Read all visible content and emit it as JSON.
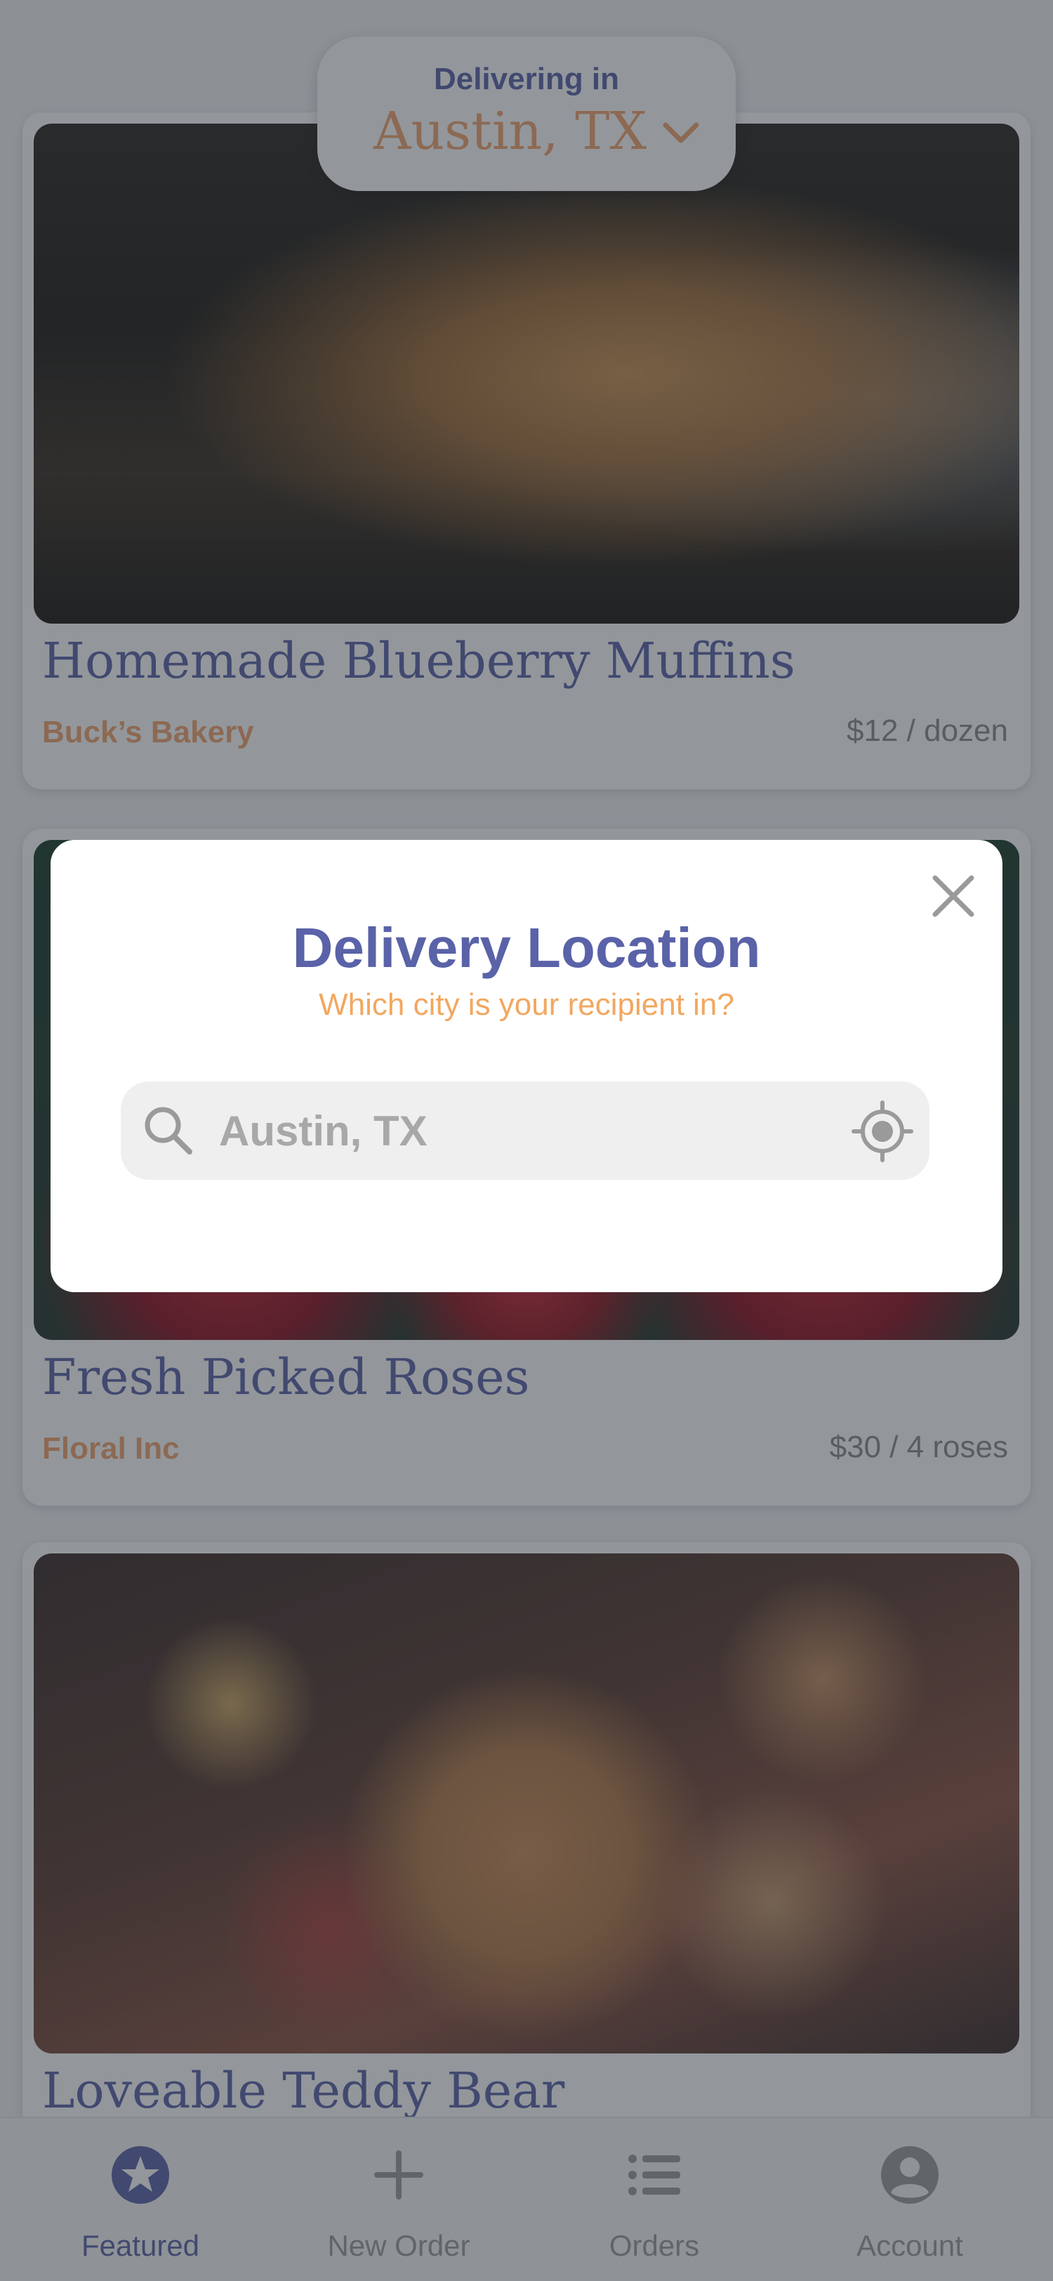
{
  "header": {
    "delivering_label": "Delivering in",
    "city": "Austin, TX"
  },
  "products": [
    {
      "title": "Homemade Blueberry Muffins",
      "shop": "Buck’s Bakery",
      "price": "$12 / dozen",
      "image": "muffins-photo"
    },
    {
      "title": "Fresh Picked Roses",
      "shop": "Floral Inc",
      "price": "$30 / 4 roses",
      "image": "roses-photo"
    },
    {
      "title": "Loveable Teddy Bear",
      "image": "teddy-bear-photo"
    }
  ],
  "modal": {
    "title": "Delivery Location",
    "subtitle": "Which city is your recipient in?",
    "search_placeholder": "Austin, TX",
    "search_value": ""
  },
  "tabbar": {
    "tabs": [
      {
        "label": "Featured",
        "icon": "star-icon",
        "active": true
      },
      {
        "label": "New Order",
        "icon": "plus-icon",
        "active": false
      },
      {
        "label": "Orders",
        "icon": "list-icon",
        "active": false
      },
      {
        "label": "Account",
        "icon": "account-icon",
        "active": false
      }
    ]
  },
  "colors": {
    "brand_blue": "#5a62a8",
    "accent_orange": "#f0a36e",
    "muted_gray": "#9a9a9a",
    "overlay": "rgba(40,48,56,0.5)"
  }
}
